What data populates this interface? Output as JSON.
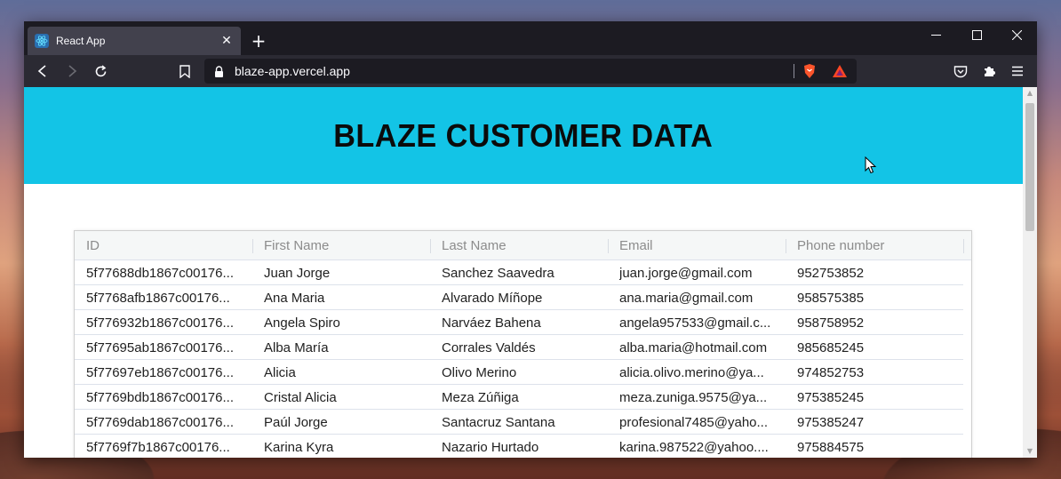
{
  "browser": {
    "tab_title": "React App",
    "tab_close": "✕",
    "new_tab": "+",
    "url": "blaze-app.vercel.app",
    "window_controls": {
      "minimize": "—",
      "maximize": "☐",
      "close": "✕"
    },
    "icons": [
      "back-icon",
      "forward-icon",
      "reload-icon",
      "bookmark-icon",
      "lock-icon",
      "brave-shield-icon",
      "bat-rewards-icon",
      "pocket-icon",
      "extensions-icon",
      "menu-icon"
    ]
  },
  "page": {
    "title": "BLAZE CUSTOMER DATA",
    "accent_color": "#13c4e6"
  },
  "table": {
    "columns": [
      "ID",
      "First Name",
      "Last Name",
      "Email",
      "Phone number"
    ],
    "rows": [
      [
        "5f77688db1867c00176...",
        "Juan Jorge",
        "Sanchez Saavedra",
        "juan.jorge@gmail.com",
        "952753852"
      ],
      [
        "5f7768afb1867c00176...",
        "Ana Maria",
        "Alvarado Míñope",
        "ana.maria@gmail.com",
        "958575385"
      ],
      [
        "5f776932b1867c00176...",
        "Angela Spiro",
        "Narváez Bahena",
        "angela957533@gmail.c...",
        "958758952"
      ],
      [
        "5f77695ab1867c00176...",
        "Alba María",
        "Corrales Valdés",
        "alba.maria@hotmail.com",
        "985685245"
      ],
      [
        "5f77697eb1867c00176...",
        "Alicia",
        "Olivo Merino",
        "alicia.olivo.merino@ya...",
        "974852753"
      ],
      [
        "5f7769bdb1867c00176...",
        "Cristal Alicia",
        "Meza Zúñiga",
        "meza.zuniga.9575@ya...",
        "975385245"
      ],
      [
        "5f7769dab1867c00176...",
        "Paúl Jorge",
        "Santacruz Santana",
        "profesional7485@yaho...",
        "975385247"
      ],
      [
        "5f7769f7b1867c00176...",
        "Karina Kyra",
        "Nazario Hurtado",
        "karina.987522@yahoo....",
        "975884575"
      ]
    ]
  }
}
